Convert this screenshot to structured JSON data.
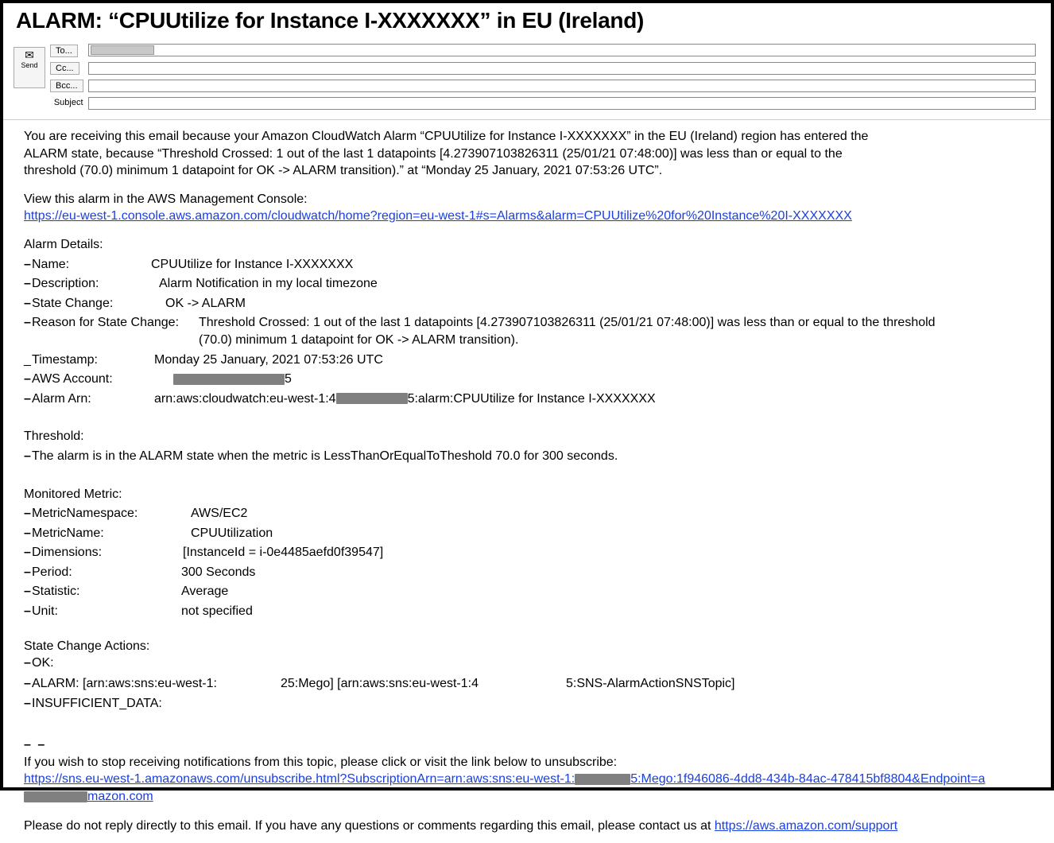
{
  "title": "ALARM: “CPUUtilize for Instance I-XXXXXXX” in EU (Ireland)",
  "compose": {
    "send": "Send",
    "to": "To...",
    "cc": "Cc...",
    "bcc": "Bcc...",
    "subject": "Subject"
  },
  "intro": "You are receiving this email because your Amazon CloudWatch Alarm “CPUUtilize for Instance I-XXXXXXX” in the EU (Ireland) region has entered the ALARM state, because “Threshold Crossed: 1 out of the last 1 datapoints [4.273907103826311 (25/01/21 07:48:00)] was less than or equal to the threshold (70.0) minimum 1 datapoint for OK -> ALARM transition).” at “Monday 25 January, 2021 07:53:26 UTC”.",
  "view_label": "View this alarm in the AWS Management Console:",
  "view_url": "https://eu-west-1.console.aws.amazon.com/cloudwatch/home?region=eu-west-1#s=Alarms&alarm=CPUUtilize%20for%20Instance%20I-XXXXXXX",
  "alarm_details": {
    "heading": "Alarm Details:",
    "name_k": "Name:",
    "name_v": "CPUUtilize for Instance I-XXXXXXX",
    "desc_k": "Description:",
    "desc_v": "Alarm Notification in my local timezone",
    "state_k": "State Change:",
    "state_v": "OK -> ALARM",
    "reason_k": "Reason for State Change:",
    "reason_v": "Threshold Crossed: 1 out of the last 1 datapoints [4.273907103826311 (25/01/21 07:48:00)] was less than or equal to the threshold (70.0) minimum 1 datapoint for OK -> ALARM transition).",
    "ts_k": "Timestamp:",
    "ts_v": "Monday 25 January, 2021 07:53:26 UTC",
    "acct_k": "AWS Account:",
    "acct_suffix": "5",
    "arn_k": "Alarm Arn:",
    "arn_pre": "arn:aws:cloudwatch:eu-west-1:4",
    "arn_post": "5:alarm:CPUUtilize for Instance I-XXXXXXX"
  },
  "threshold": {
    "heading": "Threshold:",
    "text": "The alarm is in the ALARM state when the metric is LessThanOrEqualToTheshold 70.0 for 300 seconds."
  },
  "metric": {
    "heading": "Monitored Metric:",
    "ns_k": "MetricNamespace:",
    "ns_v": "AWS/EC2",
    "name_k": "MetricName:",
    "name_v": "CPUUtilization",
    "dim_k": "Dimensions:",
    "dim_v": "[InstanceId = i-0e4485aefd0f39547]",
    "period_k": "Period:",
    "period_v": "300 Seconds",
    "stat_k": "Statistic:",
    "stat_v": "Average",
    "unit_k": "Unit:",
    "unit_v": "not specified"
  },
  "actions": {
    "heading": "State Change Actions:",
    "ok_k": "OK:",
    "alarm_pre": "ALARM: [arn:aws:sns:eu-west-1:",
    "alarm_mid": "25:Mego] [arn:aws:sns:eu-west-1:4",
    "alarm_post": "5:SNS-AlarmActionSNSTopic]",
    "insuf_k": "INSUFFICIENT_DATA:"
  },
  "footer": {
    "unsub_intro": "If you wish to stop receiving notifications from this topic, please click or visit the link below to unsubscribe:",
    "unsub_pre": "https://sns.eu-west-1.amazonaws.com/unsubscribe.html?SubscriptionArn=arn:aws:sns:eu-west-1:",
    "unsub_mid": "5:Mego:1f946086-4dd8-434b-84ac-478415bf8804&Endpoint=a",
    "unsub_post": "mazon.com",
    "noreply_pre": "Please do not reply directly to this email. If you have any questions or comments regarding this email, please contact us at ",
    "noreply_link": "https://aws.amazon.com/support"
  }
}
